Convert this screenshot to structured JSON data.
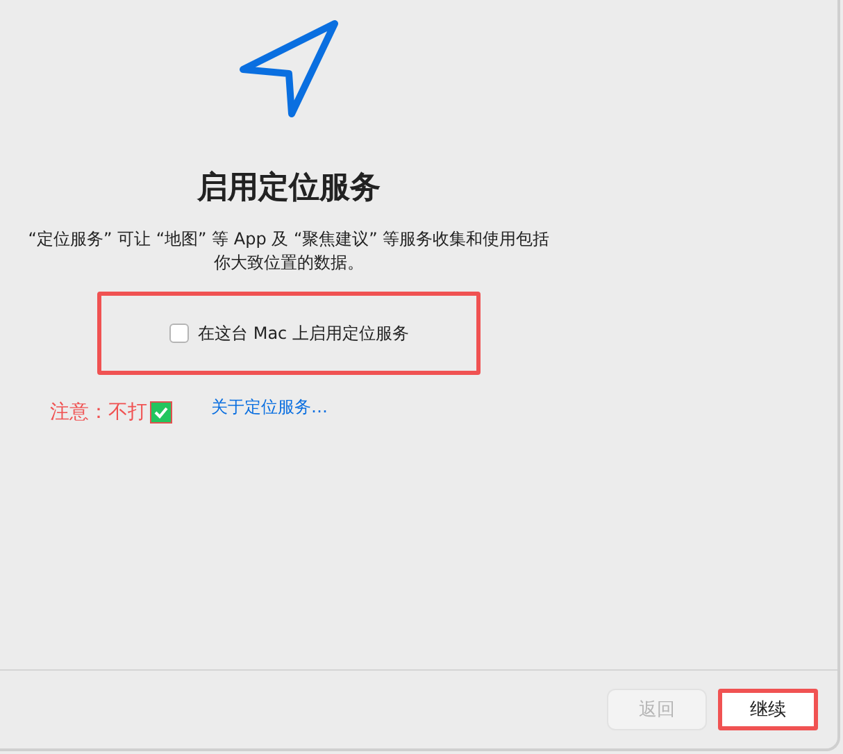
{
  "title": "启用定位服务",
  "description": "“定位服务” 可让 “地图” 等 App 及 “聚焦建议” 等服务收集和使用包括你大致位置的数据。",
  "checkbox": {
    "label": "在这台 Mac 上启用定位服务",
    "checked": false,
    "highlighted": true
  },
  "annotation": {
    "text": "注意：不打",
    "checked": true
  },
  "link": "关于定位服务…",
  "buttons": [
    {
      "label": "返回",
      "disabled": true,
      "highlighted": false
    },
    {
      "label": "继续",
      "disabled": false,
      "highlighted": true
    }
  ]
}
